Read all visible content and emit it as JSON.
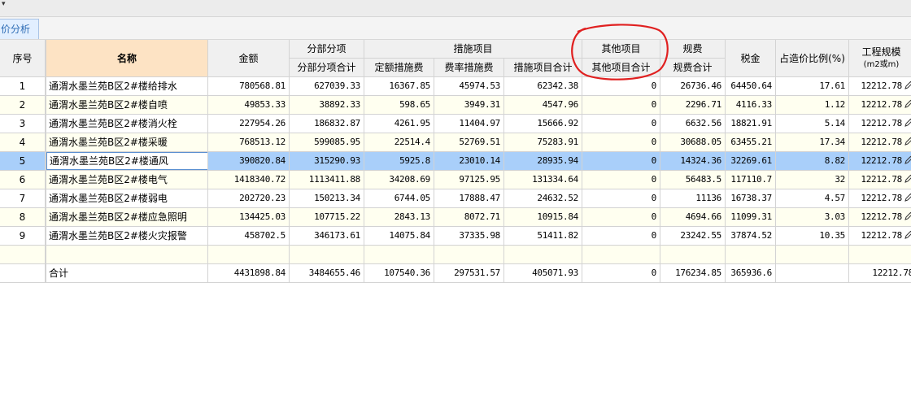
{
  "window": {
    "menu_arrow": "▾"
  },
  "tabs": [
    {
      "label": "价分析"
    }
  ],
  "table": {
    "headers": {
      "seq": "序号",
      "name": "名称",
      "amount": "金额",
      "fbfx_group": "分部分项",
      "fbfx_total": "分部分项合计",
      "csxm_group": "措施项目",
      "dingecs": "定额措施费",
      "feilvcs": "费率措施费",
      "cs_total": "措施项目合计",
      "qtxm_group": "其他项目",
      "qtxm_total": "其他项目合计",
      "guifei_group": "规费",
      "guifei_total": "规费合计",
      "tax": "税金",
      "ratio": "占造价比例(%)",
      "scale_line1": "工程规模",
      "scale_line2": "(m2或m)"
    },
    "rows": [
      {
        "seq": "1",
        "name": "通渭水墨兰苑B区2#楼给排水",
        "amount": "780568.81",
        "fbfx": "627039.33",
        "dinge": "16367.85",
        "feilv": "45974.53",
        "cs": "62342.38",
        "qt": "0",
        "gf": "26736.46",
        "tax": "64450.64",
        "ratio": "17.61",
        "scale": "12212.78"
      },
      {
        "seq": "2",
        "name": "通渭水墨兰苑B区2#楼自喷",
        "amount": "49853.33",
        "fbfx": "38892.33",
        "dinge": "598.65",
        "feilv": "3949.31",
        "cs": "4547.96",
        "qt": "0",
        "gf": "2296.71",
        "tax": "4116.33",
        "ratio": "1.12",
        "scale": "12212.78"
      },
      {
        "seq": "3",
        "name": "通渭水墨兰苑B区2#楼消火栓",
        "amount": "227954.26",
        "fbfx": "186832.87",
        "dinge": "4261.95",
        "feilv": "11404.97",
        "cs": "15666.92",
        "qt": "0",
        "gf": "6632.56",
        "tax": "18821.91",
        "ratio": "5.14",
        "scale": "12212.78"
      },
      {
        "seq": "4",
        "name": "通渭水墨兰苑B区2#楼采暖",
        "amount": "768513.12",
        "fbfx": "599085.95",
        "dinge": "22514.4",
        "feilv": "52769.51",
        "cs": "75283.91",
        "qt": "0",
        "gf": "30688.05",
        "tax": "63455.21",
        "ratio": "17.34",
        "scale": "12212.78"
      },
      {
        "seq": "5",
        "name": "通渭水墨兰苑B区2#楼通风",
        "amount": "390820.84",
        "fbfx": "315290.93",
        "dinge": "5925.8",
        "feilv": "23010.14",
        "cs": "28935.94",
        "qt": "0",
        "gf": "14324.36",
        "tax": "32269.61",
        "ratio": "8.82",
        "scale": "12212.78"
      },
      {
        "seq": "6",
        "name": "通渭水墨兰苑B区2#楼电气",
        "amount": "1418340.72",
        "fbfx": "1113411.88",
        "dinge": "34208.69",
        "feilv": "97125.95",
        "cs": "131334.64",
        "qt": "0",
        "gf": "56483.5",
        "tax": "117110.7",
        "ratio": "32",
        "scale": "12212.78"
      },
      {
        "seq": "7",
        "name": "通渭水墨兰苑B区2#楼弱电",
        "amount": "202720.23",
        "fbfx": "150213.34",
        "dinge": "6744.05",
        "feilv": "17888.47",
        "cs": "24632.52",
        "qt": "0",
        "gf": "11136",
        "tax": "16738.37",
        "ratio": "4.57",
        "scale": "12212.78"
      },
      {
        "seq": "8",
        "name": "通渭水墨兰苑B区2#楼应急照明",
        "amount": "134425.03",
        "fbfx": "107715.22",
        "dinge": "2843.13",
        "feilv": "8072.71",
        "cs": "10915.84",
        "qt": "0",
        "gf": "4694.66",
        "tax": "11099.31",
        "ratio": "3.03",
        "scale": "12212.78"
      },
      {
        "seq": "9",
        "name": "通渭水墨兰苑B区2#楼火灾报警",
        "amount": "458702.5",
        "fbfx": "346173.61",
        "dinge": "14075.84",
        "feilv": "37335.98",
        "cs": "51411.82",
        "qt": "0",
        "gf": "23242.55",
        "tax": "37874.52",
        "ratio": "10.35",
        "scale": "12212.78"
      }
    ],
    "selected_row": 4,
    "total": {
      "label": "合计",
      "amount": "4431898.84",
      "fbfx": "3484655.46",
      "dinge": "107540.36",
      "feilv": "297531.57",
      "cs": "405071.93",
      "qt": "0",
      "gf": "176234.85",
      "tax": "365936.6",
      "ratio": "",
      "scale": "12212.78"
    }
  },
  "colors": {
    "selected_row": "#a9cffa",
    "name_header": "#fde3c4",
    "row_tint": "#fffff0",
    "annotation": "#e02020"
  }
}
